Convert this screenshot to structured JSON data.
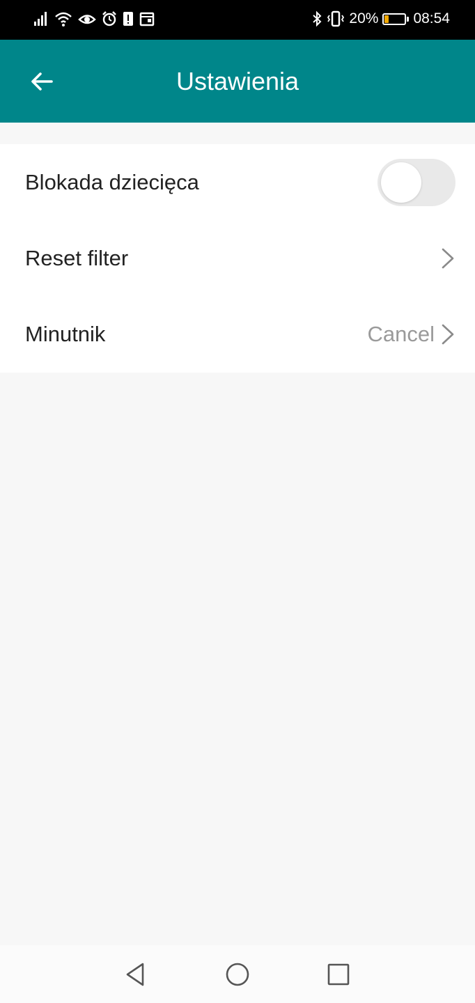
{
  "status_bar": {
    "battery_percent_text": "20%",
    "battery_level": 0.2,
    "time": "08:54",
    "left_icons": [
      "signal-icon",
      "wifi-icon",
      "eye-icon",
      "alarm-icon",
      "alert-icon",
      "calendar-icon"
    ],
    "right_icons": [
      "bluetooth-icon",
      "vibrate-icon",
      "battery-icon"
    ]
  },
  "app_bar": {
    "title": "Ustawienia",
    "back_icon": "arrow-left-icon",
    "color": "#00868a"
  },
  "settings": {
    "child_lock": {
      "label": "Blokada dziecięca",
      "enabled": false
    },
    "reset_filter": {
      "label": "Reset filter"
    },
    "timer": {
      "label": "Minutnik",
      "value": "Cancel"
    }
  },
  "nav_bar": {
    "buttons": [
      "back-triangle-icon",
      "home-circle-icon",
      "recents-square-icon"
    ]
  }
}
